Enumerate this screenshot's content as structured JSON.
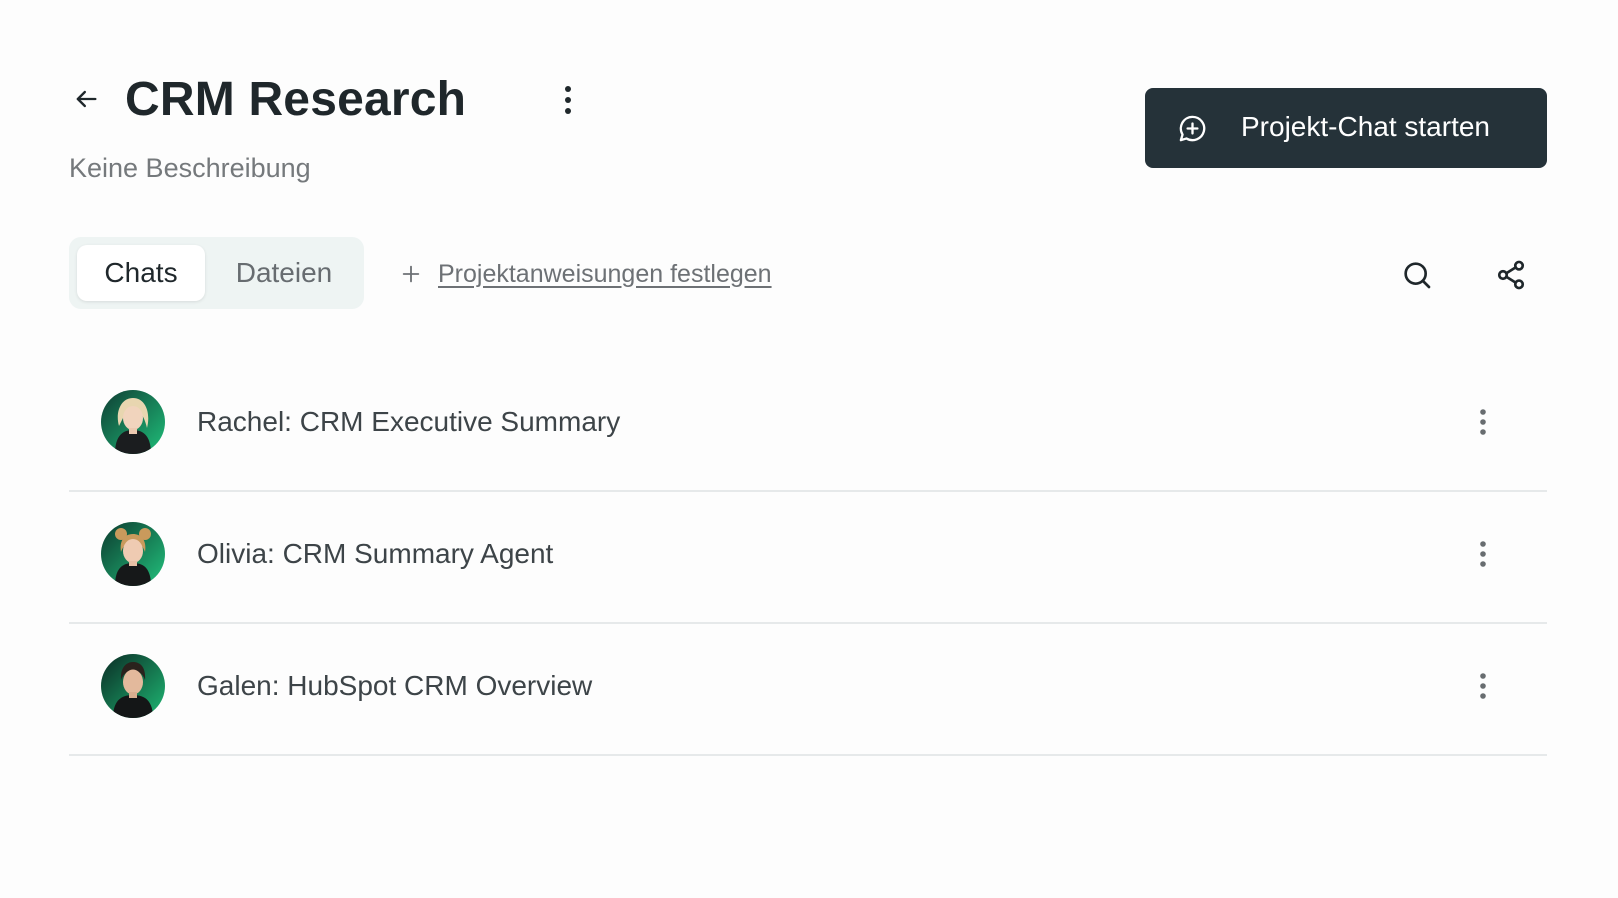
{
  "header": {
    "title": "CRM Research",
    "subtitle": "Keine Beschreibung",
    "start_chat_label": "Projekt-Chat starten"
  },
  "tabs": [
    {
      "label": "Chats",
      "active": true
    },
    {
      "label": "Dateien",
      "active": false
    }
  ],
  "instructions_link": "Projektanweisungen festlegen",
  "chats": [
    {
      "title": "Rachel: CRM Executive Summary",
      "avatar": "rachel-avatar"
    },
    {
      "title": "Olivia: CRM Summary Agent",
      "avatar": "olivia-avatar"
    },
    {
      "title": "Galen: HubSpot CRM Overview",
      "avatar": "galen-avatar"
    }
  ],
  "icons": {
    "back": "arrow-left-icon",
    "title_menu": "vertical-dots-icon",
    "start_chat": "chat-plus-icon",
    "instructions": "plus-icon",
    "search": "search-icon",
    "share": "share-icon",
    "row_menu": "vertical-dots-icon"
  },
  "colors": {
    "primary_button": "#253239",
    "tab_bar_bg": "#eef4f3",
    "avatar_accent": "#1fbf7a"
  }
}
